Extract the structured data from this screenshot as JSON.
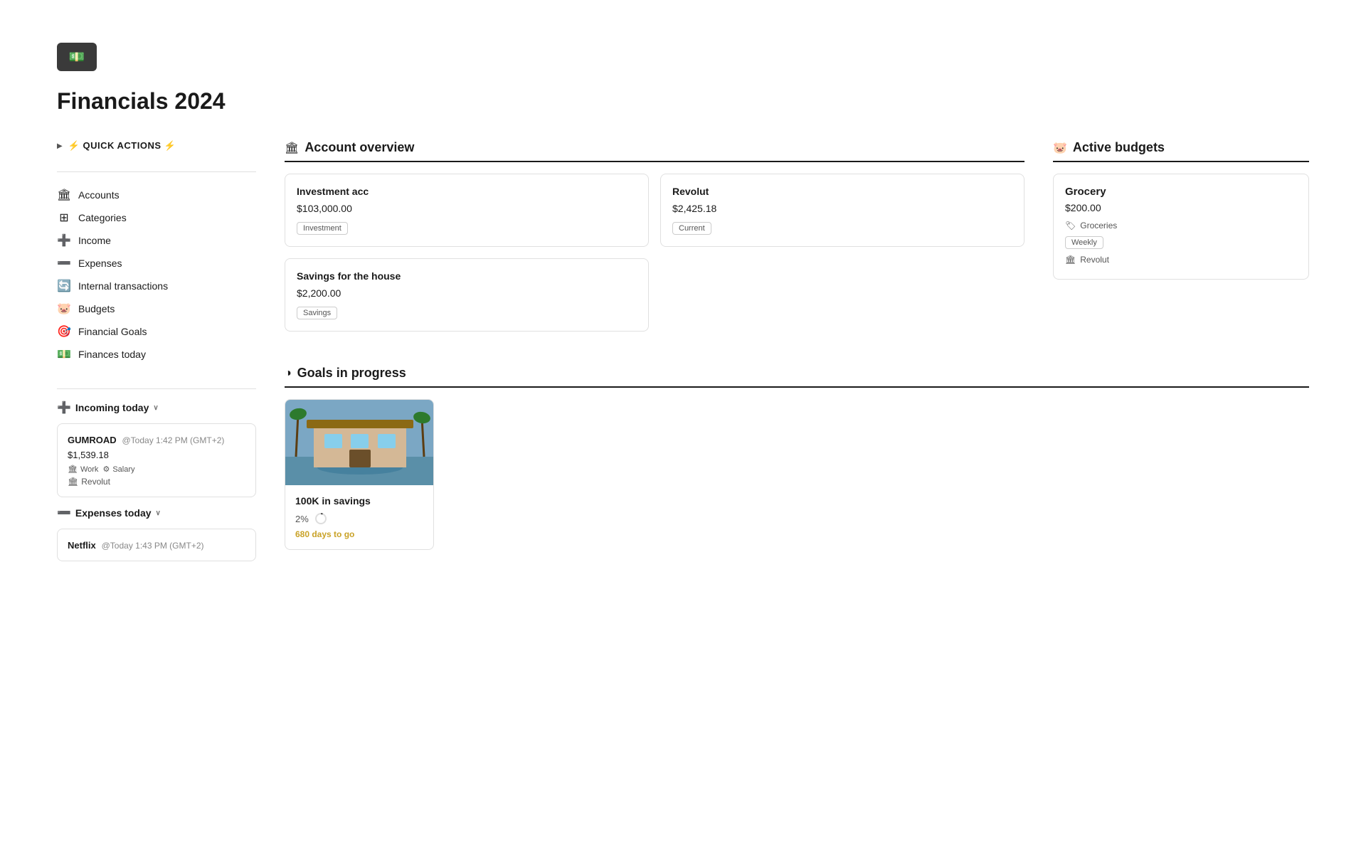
{
  "page": {
    "title": "Financials 2024"
  },
  "logo": {
    "icon": "💵"
  },
  "quick_actions": {
    "label": "⚡ QUICK ACTIONS ⚡",
    "arrow": "▶"
  },
  "nav": {
    "items": [
      {
        "id": "accounts",
        "label": "Accounts",
        "icon": "🏛"
      },
      {
        "id": "categories",
        "label": "Categories",
        "icon": "⊞"
      },
      {
        "id": "income",
        "label": "Income",
        "icon": "➕"
      },
      {
        "id": "expenses",
        "label": "Expenses",
        "icon": "➖"
      },
      {
        "id": "internal-transactions",
        "label": "Internal transactions",
        "icon": "🔄"
      },
      {
        "id": "budgets",
        "label": "Budgets",
        "icon": "🐷"
      },
      {
        "id": "financial-goals",
        "label": "Financial Goals",
        "icon": "🎯"
      },
      {
        "id": "finances-today",
        "label": "Finances today",
        "icon": "💵"
      }
    ]
  },
  "incoming_today": {
    "label": "Incoming today",
    "chevron": "∨",
    "transactions": [
      {
        "name": "GUMROAD",
        "time": "@Today 1:42 PM (GMT+2)",
        "amount": "$1,539.18",
        "tags": [
          {
            "icon": "🏛",
            "label": "Work"
          },
          {
            "icon": "⚙",
            "label": "Salary"
          }
        ],
        "account": "Revolut"
      }
    ]
  },
  "expenses_today": {
    "label": "Expenses today",
    "chevron": "∨",
    "transactions": [
      {
        "name": "Netflix",
        "time": "@Today 1:43 PM (GMT+2)",
        "amount": ""
      }
    ]
  },
  "account_overview": {
    "title": "Account overview",
    "icon": "🏛",
    "accounts": [
      {
        "name": "Investment acc",
        "amount": "$103,000.00",
        "type": "Investment"
      },
      {
        "name": "Revolut",
        "amount": "$2,425.18",
        "type": "Current"
      },
      {
        "name": "Savings for the house",
        "amount": "$2,200.00",
        "type": "Savings"
      }
    ]
  },
  "active_budgets": {
    "title": "Active budgets",
    "icon": "🐷",
    "budgets": [
      {
        "name": "Grocery",
        "amount": "$200.00",
        "category_icon": "🏷",
        "category": "Groceries",
        "period": "Weekly",
        "account_icon": "🏛",
        "account": "Revolut"
      }
    ]
  },
  "goals_in_progress": {
    "title": "Goals in progress",
    "icon": "◑",
    "goals": [
      {
        "name": "100K in savings",
        "percent": "2%",
        "days_to_go": "680 days to go"
      }
    ]
  }
}
